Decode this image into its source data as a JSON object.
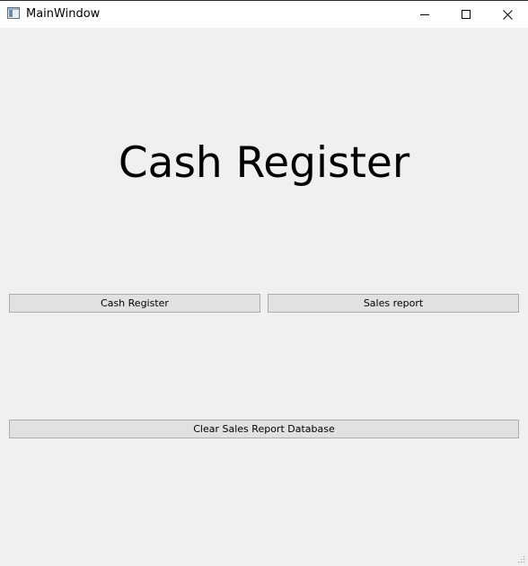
{
  "window": {
    "title": "MainWindow"
  },
  "titlebar_controls": {
    "minimize_icon": "minimize-icon",
    "maximize_icon": "maximize-icon",
    "close_icon": "close-icon"
  },
  "main": {
    "heading": "Cash Register",
    "buttons": {
      "cash_register": "Cash Register",
      "sales_report": "Sales report",
      "clear_database": "Clear Sales Report Database"
    }
  },
  "colors": {
    "background": "#f0f0f0",
    "titlebar": "#ffffff",
    "button_face": "#e1e1e1",
    "button_border": "#adadad"
  }
}
